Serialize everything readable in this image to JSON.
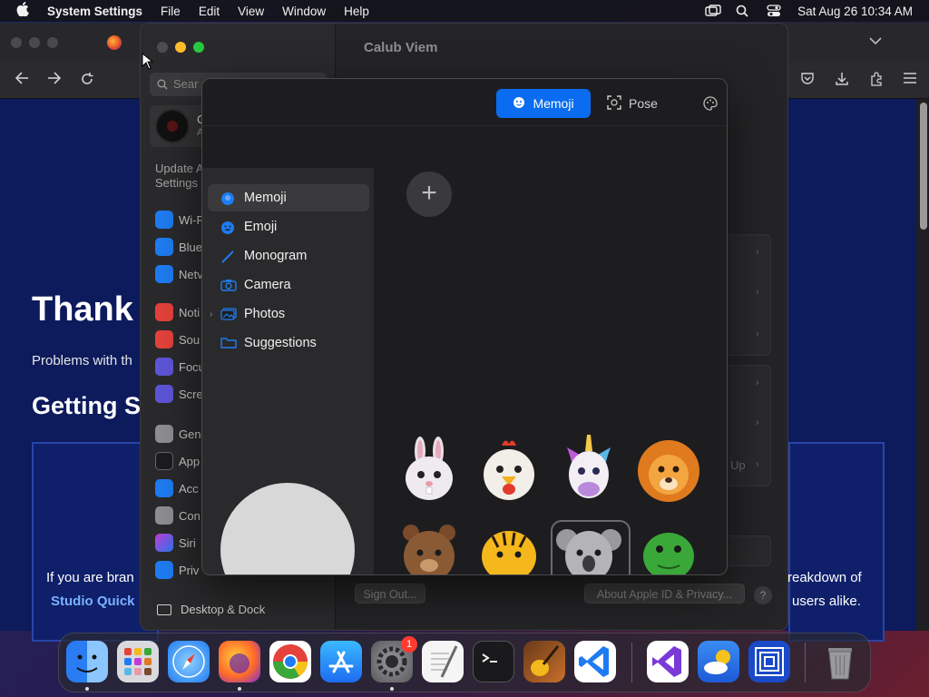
{
  "menubar": {
    "app_name": "System Settings",
    "items": [
      "File",
      "Edit",
      "View",
      "Window",
      "Help"
    ],
    "datetime": "Sat Aug 26  10:34 AM"
  },
  "browser": {
    "page": {
      "title": "Thank",
      "subtitle": "Problems with th",
      "heading": "Getting S",
      "card_left_text": "If you are bran",
      "card_left_link": "Studio Quick",
      "card_right_text": "reakdown of",
      "card_right_text2": "users alike."
    }
  },
  "settings": {
    "search_placeholder": "Sear",
    "account_initial": "C",
    "account_sub": "A",
    "update_text_1": "Update A",
    "update_text_2": "Settings",
    "nav": [
      {
        "label": "Wi-F",
        "icon": "wifi-icon",
        "color": "#1e7cf2"
      },
      {
        "label": "Blue",
        "icon": "bluetooth-icon",
        "color": "#1e7cf2"
      },
      {
        "label": "Netv",
        "icon": "network-icon",
        "color": "#1e7cf2"
      },
      {
        "label": "Noti",
        "icon": "notifications-icon",
        "color": "#e5423b"
      },
      {
        "label": "Sou",
        "icon": "sound-icon",
        "color": "#e5423b"
      },
      {
        "label": "Focu",
        "icon": "focus-icon",
        "color": "#5e55d8"
      },
      {
        "label": "Scre",
        "icon": "screen-time-icon",
        "color": "#5e55d8"
      },
      {
        "label": "Gen",
        "icon": "general-icon",
        "color": "#8e8e93"
      },
      {
        "label": "App",
        "icon": "appearance-icon",
        "color": "#1c1c1e"
      },
      {
        "label": "Acc",
        "icon": "accessibility-icon",
        "color": "#1e7cf2"
      },
      {
        "label": "Con",
        "icon": "control-center-icon",
        "color": "#8e8e93"
      },
      {
        "label": "Siri",
        "icon": "siri-icon",
        "color": "#c43bd8"
      },
      {
        "label": "Priv",
        "icon": "privacy-icon",
        "color": "#1e7cf2"
      }
    ],
    "desktop_dock": "Desktop & Dock",
    "main_title": "Calub Viem",
    "sign_out": "Sign Out...",
    "about": "About Apple ID & Privacy...",
    "help": "?",
    "up_label": "Up"
  },
  "picker": {
    "tabs": {
      "memoji": "Memoji",
      "pose": "Pose"
    },
    "categories": [
      {
        "label": "Memoji",
        "icon": "memoji-icon",
        "selected": true
      },
      {
        "label": "Emoji",
        "icon": "emoji-icon",
        "selected": false
      },
      {
        "label": "Monogram",
        "icon": "monogram-icon",
        "selected": false
      },
      {
        "label": "Camera",
        "icon": "camera-icon",
        "selected": false
      },
      {
        "label": "Photos",
        "icon": "photos-icon",
        "selected": false
      },
      {
        "label": "Suggestions",
        "icon": "folder-icon",
        "selected": false
      }
    ],
    "add_symbol": "+",
    "memoji_items": [
      "bunny",
      "chicken",
      "unicorn",
      "lion",
      "bear",
      "tiger",
      "koala",
      "turtle"
    ]
  },
  "dock": {
    "apps": [
      "finder",
      "launchpad",
      "safari",
      "firefox",
      "chrome",
      "app-store",
      "system-settings",
      "textedit",
      "terminal",
      "garageband",
      "vscode",
      "visual-studio",
      "weather",
      "screen-sharing",
      "trash"
    ],
    "badge": "1"
  },
  "colors": {
    "accent": "#0a6cf0",
    "traffic_red": "#ff5f57",
    "traffic_yellow": "#febc2e",
    "traffic_green": "#28c840"
  }
}
